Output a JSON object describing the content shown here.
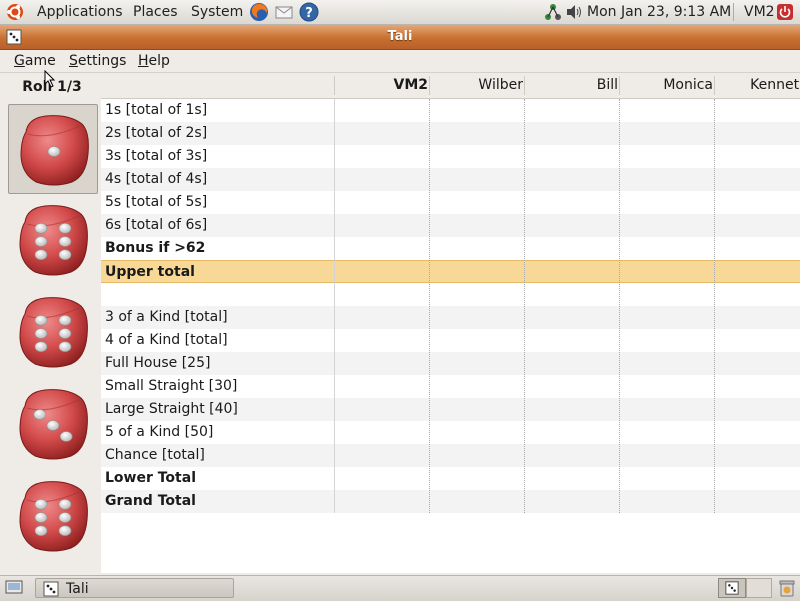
{
  "top_panel": {
    "menus": [
      "Applications",
      "Places",
      "System"
    ],
    "launchers": [
      "firefox-icon",
      "mail-icon",
      "help-icon"
    ],
    "clock": "Mon Jan 23,  9:13 AM",
    "user": "VM2"
  },
  "window": {
    "title": "Tali"
  },
  "menubar": {
    "game": {
      "mnemonic": "G",
      "rest": "ame"
    },
    "settings": {
      "mnemonic": "S",
      "rest": "ettings"
    },
    "help": {
      "mnemonic": "H",
      "rest": "elp"
    }
  },
  "dice_panel": {
    "row_label": "Roll 1/3",
    "dice": [
      {
        "value": 1,
        "selected": true
      },
      {
        "value": 6
      },
      {
        "value": 6
      },
      {
        "value": 3
      },
      {
        "value": 6
      }
    ]
  },
  "scoreboard": {
    "players": [
      "VM2",
      "Wilber",
      "Bill",
      "Monica",
      "Kenneth"
    ],
    "rows": [
      {
        "label": "1s [total of 1s]",
        "bold": false
      },
      {
        "label": "2s [total of 2s]",
        "bold": false
      },
      {
        "label": "3s [total of 3s]",
        "bold": false
      },
      {
        "label": "4s [total of 4s]",
        "bold": false
      },
      {
        "label": "5s [total of 5s]",
        "bold": false
      },
      {
        "label": "6s [total of 6s]",
        "bold": false
      },
      {
        "label": "Bonus if >62",
        "bold": true
      },
      {
        "label": "Upper total",
        "bold": true,
        "highlight": true
      },
      {
        "label": "",
        "bold": false
      },
      {
        "label": "3 of a Kind [total]",
        "bold": false
      },
      {
        "label": "4 of a Kind [total]",
        "bold": false
      },
      {
        "label": "Full House [25]",
        "bold": false
      },
      {
        "label": "Small Straight [30]",
        "bold": false
      },
      {
        "label": "Large Straight [40]",
        "bold": false
      },
      {
        "label": "5 of a Kind [50]",
        "bold": false
      },
      {
        "label": "Chance [total]",
        "bold": false
      },
      {
        "label": "Lower Total",
        "bold": true
      },
      {
        "label": "Grand Total",
        "bold": true
      }
    ]
  },
  "taskbar": {
    "task_label": "Tali"
  },
  "colors": {
    "titlebar": "#c8702f",
    "highlight_row": "#f8d897",
    "die_red": "#d24a4a"
  }
}
